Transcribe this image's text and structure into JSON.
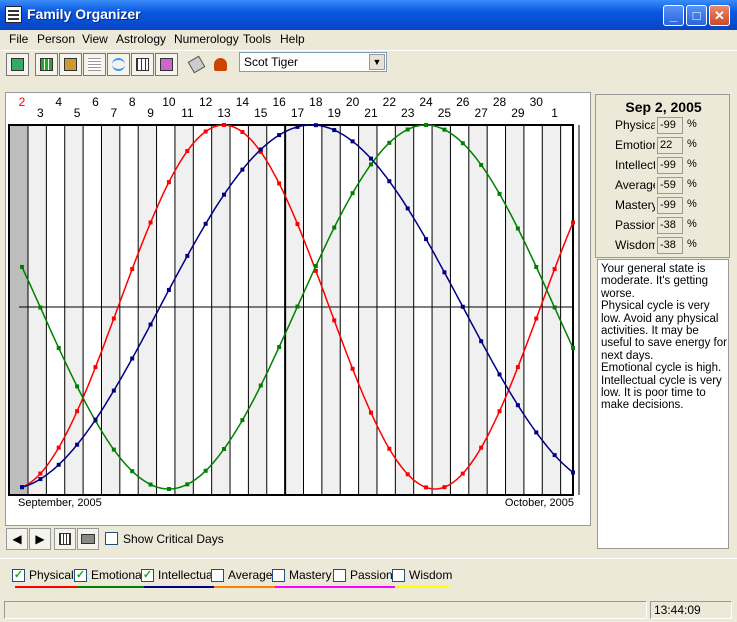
{
  "window": {
    "title": "Family Organizer",
    "buttons": {
      "minimize": "_",
      "maximize": "□",
      "close": "✕"
    }
  },
  "menu": [
    "File",
    "Person",
    "View",
    "Astrology",
    "Numerology",
    "Tools",
    "Help"
  ],
  "toolbar": {
    "icons": [
      "exit-icon",
      "grid-icon",
      "family-tree-icon",
      "lines-icon",
      "biorhythm-icon",
      "calendar-grid-icon",
      "portrait-icon",
      "eraser-icon",
      "figure-icon"
    ],
    "person_selected": "Scot Tiger"
  },
  "chart_data": {
    "type": "line",
    "x_top_labels_high": [
      "2",
      "4",
      "6",
      "8",
      "10",
      "12",
      "14",
      "16",
      "18",
      "20",
      "22",
      "24",
      "26",
      "28",
      "30"
    ],
    "x_top_labels_low": [
      "3",
      "5",
      "7",
      "9",
      "11",
      "13",
      "15",
      "17",
      "19",
      "21",
      "23",
      "25",
      "27",
      "29",
      "1"
    ],
    "current_day_label": "2",
    "x_left_label": "September, 2005",
    "x_right_label": "October, 2005",
    "days": 30,
    "ylim": [
      -100,
      100
    ],
    "series": [
      {
        "name": "Physical",
        "color": "#ff0000",
        "period": 23,
        "start_value": -99
      },
      {
        "name": "Emotional",
        "color": "#008000",
        "period": 28,
        "start_value": 22
      },
      {
        "name": "Intellectual",
        "color": "#000080",
        "period": 33,
        "start_value": -99
      }
    ]
  },
  "right_panel": {
    "date": "Sep 2, 2005",
    "stats": [
      {
        "label": "Physical",
        "value": "-99"
      },
      {
        "label": "Emotion",
        "value": "22"
      },
      {
        "label": "Intellect",
        "value": "-99"
      },
      {
        "label": "Average",
        "value": "-59"
      },
      {
        "label": "Mastery",
        "value": "-99"
      },
      {
        "label": "Passion",
        "value": "-38"
      },
      {
        "label": "Wisdom",
        "value": "-38"
      }
    ],
    "percent_sign": "%",
    "description": "Your general state is moderate. It's getting worse.\nPhysical cycle is very low. Avoid any physical activities. It may be useful to save energy for next days.\nEmotional cycle is high.\nIntellectual cycle is very low. It is poor time to make decisions."
  },
  "navbar": {
    "prev": "◀",
    "next": "▶",
    "show_critical_label": "Show Critical Days",
    "show_critical_checked": false
  },
  "legend": [
    {
      "label": "Physical",
      "checked": true,
      "color": "#ff0000"
    },
    {
      "label": "Emotional",
      "checked": true,
      "color": "#008000"
    },
    {
      "label": "Intellectual",
      "checked": true,
      "color": "#000080"
    },
    {
      "label": "Average",
      "checked": false,
      "color": "#ff8000"
    },
    {
      "label": "Mastery",
      "checked": false,
      "color": "#ff00ff"
    },
    {
      "label": "Passion",
      "checked": false,
      "color": "#ff00ff"
    },
    {
      "label": "Wisdom",
      "checked": false,
      "color": "#ffff00"
    }
  ],
  "status": {
    "time": "13:44:09"
  }
}
